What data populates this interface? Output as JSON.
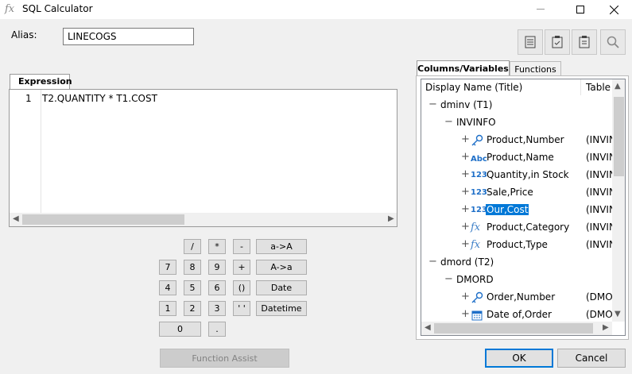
{
  "window": {
    "title": "SQL Calculator",
    "icon": "fx-icon"
  },
  "alias": {
    "label": "Alias:",
    "value": "LINECOGS"
  },
  "toolbar": [
    "list-icon",
    "clipboard-check-icon",
    "clipboard-icon",
    "search-icon"
  ],
  "expression": {
    "tab": "Expression",
    "line_number": "1",
    "text": "T2.QUANTITY * T1.COST"
  },
  "keypad": {
    "slash": "/",
    "star": "*",
    "minus": "-",
    "upper": "a->A",
    "k7": "7",
    "k8": "8",
    "k9": "9",
    "plus": "+",
    "lower": "A->a",
    "k4": "4",
    "k5": "5",
    "k6": "6",
    "parens": "()",
    "date": "Date",
    "k1": "1",
    "k2": "2",
    "k3": "3",
    "quotes": "' '",
    "datetime": "Datetime",
    "k0": "0",
    "dot": "."
  },
  "function_assist": "Function Assist",
  "tabs": {
    "columns": "Columns/Variables",
    "functions": "Functions"
  },
  "tree": {
    "headers": {
      "name": "Display Name (Title)",
      "table": "Table"
    },
    "groups": {
      "dminv": "dminv (T1)",
      "invinfo": "INVINFO",
      "dmord": "dmord (T2)",
      "dmord_seg": "DMORD"
    },
    "invinfo_items": [
      {
        "name": "Product,Number",
        "table": "(INVIN",
        "icon": "key-icon"
      },
      {
        "name": "Product,Name",
        "table": "(INVIN",
        "icon": "abc-icon"
      },
      {
        "name": "Quantity,in Stock",
        "table": "(INVIN",
        "icon": "numeric-icon"
      },
      {
        "name": "Sale,Price",
        "table": "(INVIN",
        "icon": "numeric-icon"
      },
      {
        "name": "Our,Cost",
        "table": "(INVIN",
        "icon": "numeric-icon",
        "selected": true
      },
      {
        "name": "Product,Category",
        "table": "(INVIN",
        "icon": "fx-icon"
      },
      {
        "name": "Product,Type",
        "table": "(INVIN",
        "icon": "fx-icon"
      }
    ],
    "dmord_items": [
      {
        "name": "Order,Number",
        "table": "(DMO",
        "icon": "key-icon"
      },
      {
        "name": "Date of,Order",
        "table": "(DMO",
        "icon": "calendar-icon"
      }
    ]
  },
  "buttons": {
    "ok": "OK",
    "cancel": "Cancel"
  },
  "icon_text": {
    "abc": "Abc",
    "num": "123",
    "fx": "fx",
    "expand": "+",
    "collapse": "−"
  },
  "colors": {
    "selection": "#0078d7",
    "icon_blue": "#1e6fc8"
  }
}
